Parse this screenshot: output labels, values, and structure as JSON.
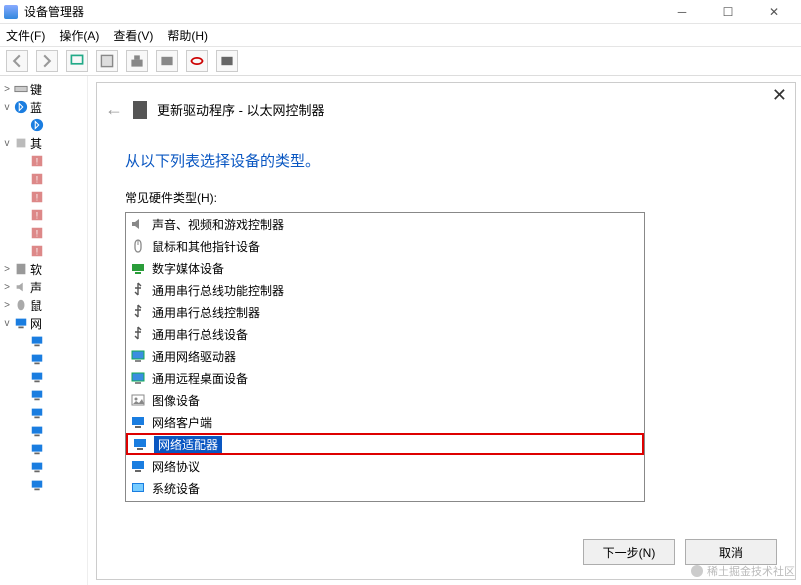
{
  "window": {
    "title": "设备管理器",
    "menu": {
      "file": "文件(F)",
      "action": "操作(A)",
      "view": "查看(V)",
      "help": "帮助(H)"
    }
  },
  "tree": {
    "items": [
      {
        "label": "键",
        "exp": ">"
      },
      {
        "label": "蓝",
        "exp": "v",
        "bt": true
      },
      {
        "label": "",
        "sub": true,
        "bticon": true
      },
      {
        "label": "其",
        "exp": "v"
      },
      {
        "label": "",
        "sub": true,
        "warn": true
      },
      {
        "label": "",
        "sub": true,
        "warn": true
      },
      {
        "label": "",
        "sub": true,
        "warn": true
      },
      {
        "label": "",
        "sub": true,
        "warn": true
      },
      {
        "label": "",
        "sub": true,
        "warn": true
      },
      {
        "label": "",
        "sub": true,
        "warn": true
      },
      {
        "label": "软",
        "exp": ">"
      },
      {
        "label": "声",
        "exp": ">"
      },
      {
        "label": "鼠",
        "exp": ">"
      },
      {
        "label": "网",
        "exp": "v",
        "net": true
      },
      {
        "label": "",
        "sub": true,
        "net": true
      },
      {
        "label": "",
        "sub": true,
        "net": true
      },
      {
        "label": "",
        "sub": true,
        "net": true
      },
      {
        "label": "",
        "sub": true,
        "net": true
      },
      {
        "label": "",
        "sub": true,
        "net": true
      },
      {
        "label": "",
        "sub": true,
        "net": true
      },
      {
        "label": "",
        "sub": true,
        "net": true
      },
      {
        "label": "",
        "sub": true,
        "net": true
      },
      {
        "label": "",
        "sub": true,
        "net": true
      }
    ]
  },
  "dialog": {
    "title": "更新驱动程序 - 以太网控制器",
    "instruction": "从以下列表选择设备的类型。",
    "list_label": "常见硬件类型(H):",
    "items": [
      {
        "label": "声音、视频和游戏控制器",
        "icon": "speaker"
      },
      {
        "label": "鼠标和其他指针设备",
        "icon": "mouse"
      },
      {
        "label": "数字媒体设备",
        "icon": "media"
      },
      {
        "label": "通用串行总线功能控制器",
        "icon": "usb"
      },
      {
        "label": "通用串行总线控制器",
        "icon": "usb"
      },
      {
        "label": "通用串行总线设备",
        "icon": "usb"
      },
      {
        "label": "通用网络驱动器",
        "icon": "monitor"
      },
      {
        "label": "通用远程桌面设备",
        "icon": "monitor"
      },
      {
        "label": "图像设备",
        "icon": "image"
      },
      {
        "label": "网络客户端",
        "icon": "netmon"
      },
      {
        "label": "网络适配器",
        "icon": "netmon",
        "selected": true,
        "boxed": true
      },
      {
        "label": "网络协议",
        "icon": "netmon"
      },
      {
        "label": "系统设备",
        "icon": "system"
      }
    ],
    "next": "下一步(N)",
    "cancel": "取消"
  },
  "watermark": "稀土掘金技术社区"
}
